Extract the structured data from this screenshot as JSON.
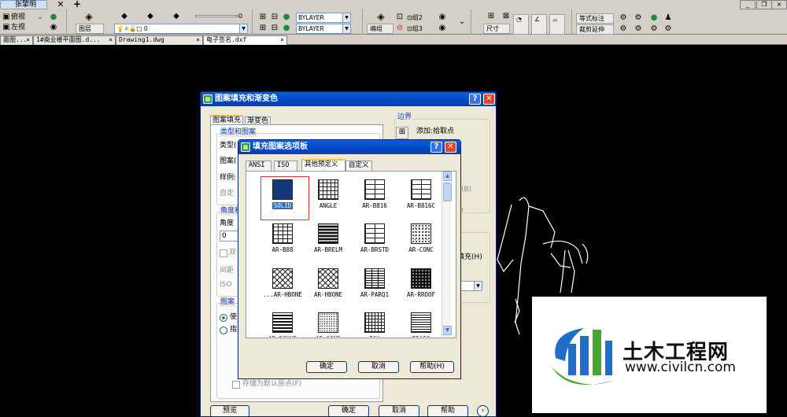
{
  "colors": {
    "canvas": "#000000",
    "chrome": "#d4d0c8",
    "title_blue": "#0a5fd8",
    "solid_fill": "#13397a",
    "selection_blue": "#316ac5",
    "highlight_red": "#e83030",
    "brand_blue": "#1f6fc7",
    "brand_green": "#46a62e"
  },
  "toolbar": {
    "user_tab": "张擎明",
    "close_glyph": "✕",
    "new_tab_glyph": "+",
    "view_top": "俯视",
    "view_left": "左视",
    "layers_btn": "图层",
    "layer_value": "0",
    "slider_value": "0",
    "color_value": "BYLAYER",
    "linetype_value": "BYLAYER",
    "group_label": "编组",
    "group2": "组2",
    "group3": "组3",
    "dimension": "尺寸",
    "text_style": "等式标注",
    "trim_extend": "裁剪延伸"
  },
  "tabs": [
    {
      "label": "面图...",
      "close": "×"
    },
    {
      "label": "1#商业楼平面图.d...",
      "close": "×"
    },
    {
      "label": "Drawing1.dwg",
      "close": "×"
    },
    {
      "label": "电子签名.dxf",
      "close": "×"
    }
  ],
  "hatch_dialog": {
    "title": "图案填充和渐变色",
    "tab_hatch": "图案填充",
    "tab_gradient": "渐变色",
    "type_group": "类型和图案",
    "type_label": "类型(",
    "pattern_label": "图案(",
    "sample_label": "样例:",
    "custom_label": "自定",
    "angle_group": "角度和",
    "angle_label": "角度",
    "angle_value": "0",
    "double_label": "双",
    "spacing_label": "间距",
    "iso_label": "ISO",
    "origin_group": "图案",
    "use_current": "使",
    "specified": "指",
    "store_default": "存储为默认原点(F)",
    "boundary_group": "边界",
    "add_pick": "添加:拾取点",
    "hidden_fill": "填充(H)",
    "preview_btn": "预览",
    "ok_btn": "确定",
    "cancel_btn": "取消",
    "help_btn": "帮助"
  },
  "palette": {
    "title": "填充图案选项板",
    "help_glyph": "?",
    "close_glyph": "✕",
    "tabs": [
      "ANSI",
      "ISO",
      "其他预定义",
      "自定义"
    ],
    "active_tab": "其他预定义",
    "patterns": [
      {
        "name": "SOLID",
        "kind": "solid"
      },
      {
        "name": "ANGLE",
        "kind": "angle"
      },
      {
        "name": "AR-B816",
        "kind": "brick"
      },
      {
        "name": "AR-B816C",
        "kind": "brick"
      },
      {
        "name": "AR-B88",
        "kind": "brick2"
      },
      {
        "name": "AR-BRELM",
        "kind": "brelm"
      },
      {
        "name": "AR-BRSTD",
        "kind": "brick"
      },
      {
        "name": "AR-CONC",
        "kind": "conc"
      },
      {
        "name": "...AR-HBONE",
        "kind": "hbone"
      },
      {
        "name": "AR-HBONE",
        "kind": "hbone"
      },
      {
        "name": "AR-PARQ1",
        "kind": "parq"
      },
      {
        "name": "AR-RROOF",
        "kind": "rroof"
      },
      {
        "name": "AR-RSHKE",
        "kind": "rshke"
      },
      {
        "name": "AR-SAND",
        "kind": "sand"
      },
      {
        "name": "BOX",
        "kind": "box"
      },
      {
        "name": "BRASS",
        "kind": "brass"
      }
    ],
    "selected": "SOLID",
    "ok_btn": "确定",
    "cancel_btn": "取消",
    "help_btn": "帮助(H)"
  },
  "watermark": {
    "name": "土木工程网",
    "url": "www.civilcn.com"
  }
}
